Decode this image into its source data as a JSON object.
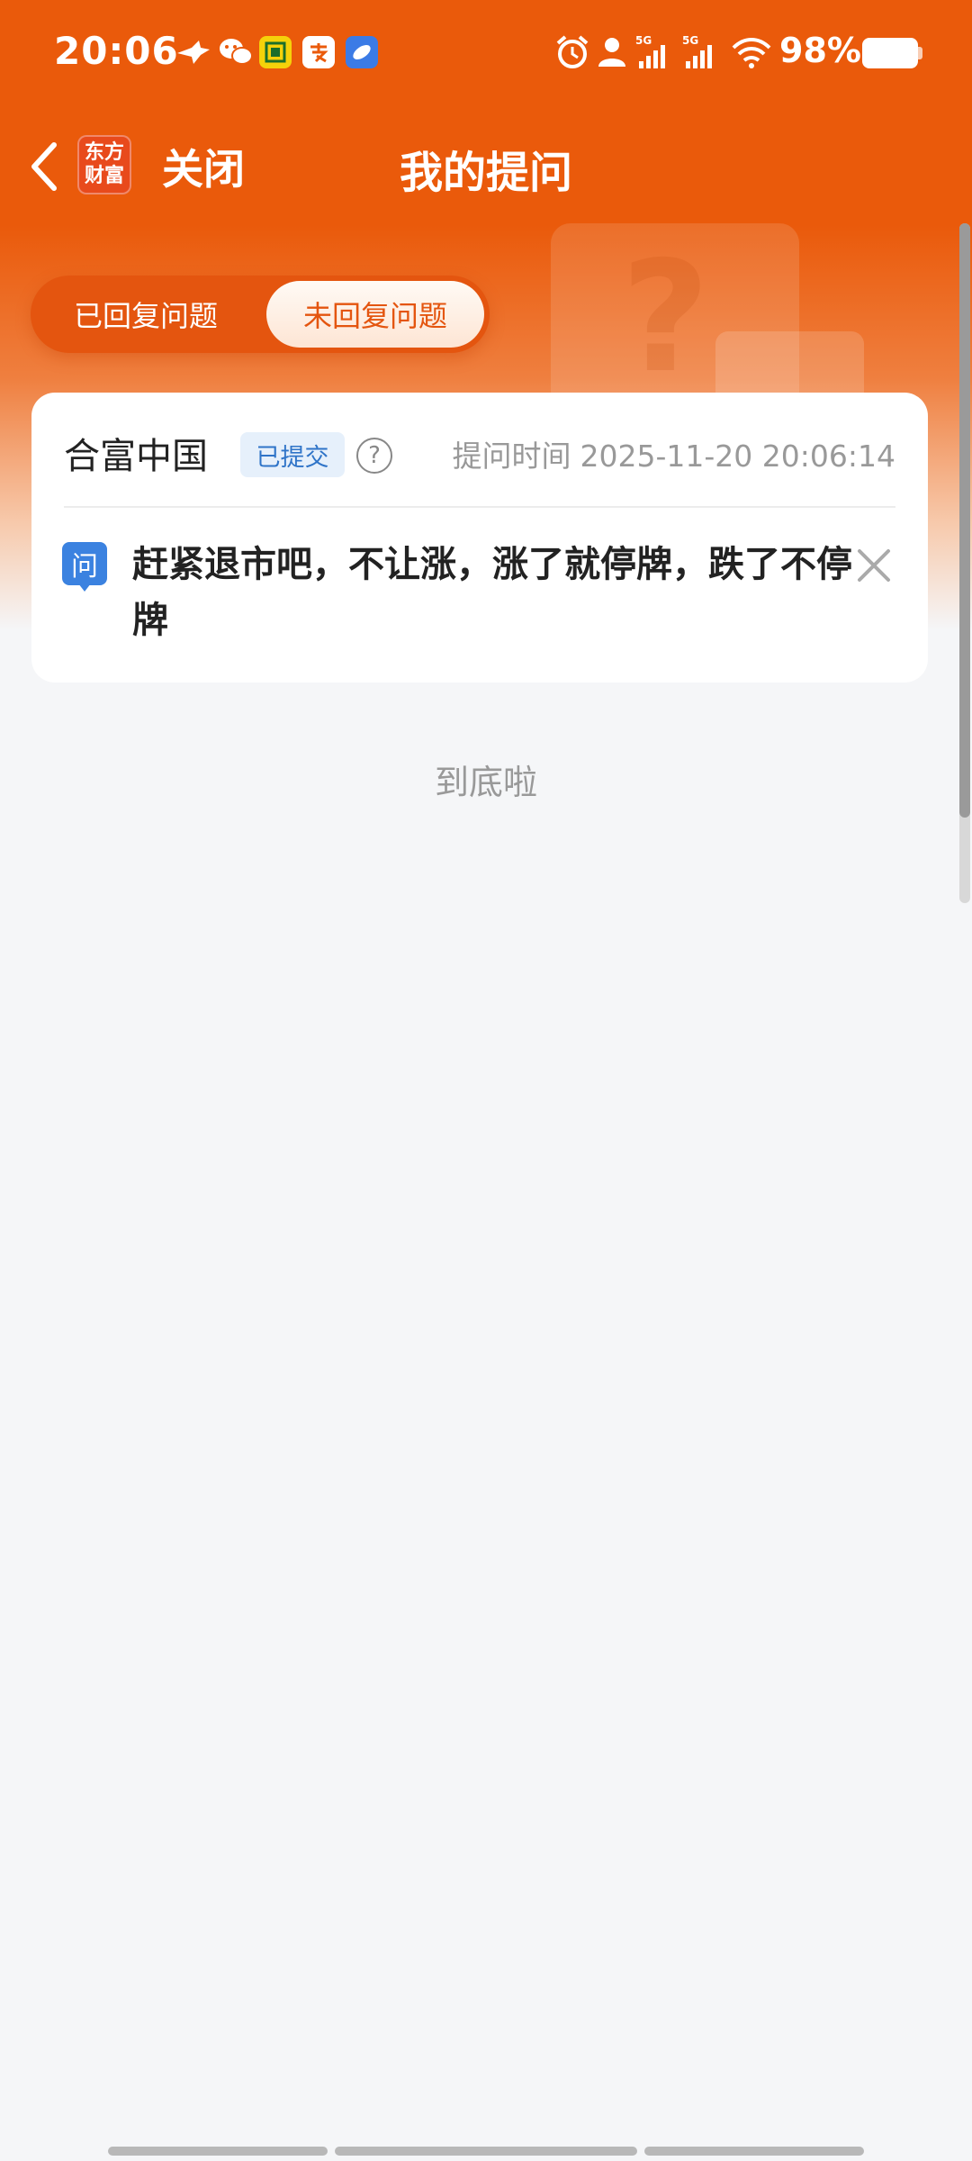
{
  "status_bar": {
    "time": "20:06",
    "app_icons": [
      "bird-icon",
      "wechat-icon",
      "cloudbox-icon",
      "alipay-icon",
      "browser-icon"
    ],
    "sys_icons": [
      "alarm-icon",
      "person-icon",
      "signal-5g-icon",
      "signal-5g-icon",
      "wifi-icon"
    ],
    "signal_label_1": "5G",
    "signal_label_2": "5G",
    "battery_percent": "98%"
  },
  "nav": {
    "logo_line1": "东方",
    "logo_line2": "财富",
    "close_label": "关闭",
    "title": "我的提问"
  },
  "tabs": [
    {
      "label": "已回复问题",
      "selected": false
    },
    {
      "label": "未回复问题",
      "selected": true
    }
  ],
  "question_card": {
    "stock_name": "合富中国",
    "status_badge": "已提交",
    "help_symbol": "?",
    "time_label": "提问时间",
    "time_value": "2025-11-20 20:06:14",
    "question_badge": "问",
    "question_text": "赶紧退市吧，不让涨，涨了就停牌，跌了不停牌"
  },
  "list_end_text": "到底啦",
  "colors": {
    "brand_orange": "#ea5a0b",
    "badge_blue": "#2f74c8",
    "question_icon_blue": "#3b82e0",
    "page_bg": "#f5f6f8"
  }
}
